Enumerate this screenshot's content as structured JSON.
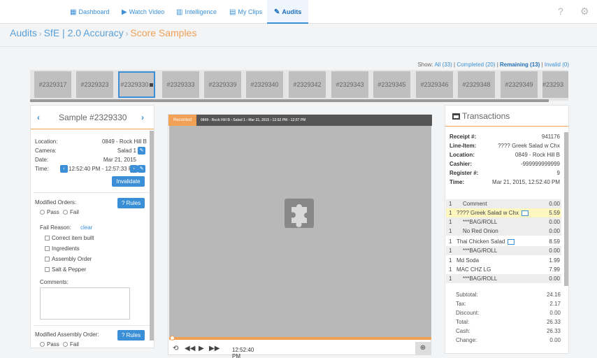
{
  "nav": {
    "items": [
      {
        "label": "Dashboard",
        "icon": "dashboard-icon",
        "active": false
      },
      {
        "label": "Watch Video",
        "icon": "play-circle-icon",
        "active": false
      },
      {
        "label": "Intelligence",
        "icon": "bar-chart-icon",
        "active": false
      },
      {
        "label": "My Clips",
        "icon": "film-icon",
        "active": false
      },
      {
        "label": "Audits",
        "icon": "edit-icon",
        "active": true
      }
    ],
    "help_icon": "help-icon",
    "settings_icon": "gear-icon"
  },
  "breadcrumb": {
    "items": [
      "Audits",
      "SfE | 2.0 Accuracy"
    ],
    "current": "Score Samples"
  },
  "filters": {
    "label": "Show:",
    "all": "All (33)",
    "completed": "Completed (20)",
    "remaining": "Remaining (13)",
    "invalid": "Invalid (0)"
  },
  "samples": [
    "#2329317",
    "#2329323",
    "#2329330",
    "#2329333",
    "#2329339",
    "#2329340",
    "#2329342",
    "#2329343",
    "#2329345",
    "#2329346",
    "#2329348",
    "#2329349",
    "#23293"
  ],
  "selected_sample": "#2329330",
  "sample": {
    "title": "Sample #2329330",
    "location_label": "Location:",
    "location": "0849 - Rock Hill B",
    "camera_label": "Camera:",
    "camera": "Salad 1",
    "date_label": "Date:",
    "date": "Mar 21, 2015",
    "time_label": "Time:",
    "time": "12:52:40 PM - 12:57:33 PM",
    "invalidate": "Invalidate",
    "modified_orders": "Modified Orders:",
    "rules": "? Rules",
    "pass": "Pass",
    "fail": "Fail",
    "fail_reason": "Fail Reason:",
    "clear": "clear",
    "reasons": [
      "Correct item built",
      "Ingredients",
      "Assembly Order",
      "Salt & Pepper"
    ],
    "comments": "Comments:",
    "modified_assembly": "Modified Assembly Order:"
  },
  "video": {
    "badge": "Recorded",
    "info": "0849 - Rock Hill B › Salad 1 › Mar 21, 2015 › 12:52 PM - 12:57 PM",
    "current_time": "12:52:40 PM"
  },
  "transactions": {
    "title": "Transactions",
    "fields": [
      {
        "label": "Receipt #:",
        "value": "941176"
      },
      {
        "label": "Line-Item:",
        "value": "???? Greek Salad w Chx"
      },
      {
        "label": "Location:",
        "value": "0849 - Rock Hill B"
      },
      {
        "label": "Cashier:",
        "value": "-999999999999"
      },
      {
        "label": "Register #:",
        "value": "9"
      },
      {
        "label": "Time:",
        "value": "Mar 21, 2015, 12:52:40 PM"
      }
    ],
    "items": [
      {
        "qty": "1",
        "name": "Comment",
        "amount": "0.00",
        "style": "shade"
      },
      {
        "qty": "1",
        "name": "???? Greek Salad w Chx",
        "amount": "5.59",
        "style": "hl"
      },
      {
        "qty": "1",
        "name": "***BAG/ROLL",
        "amount": "0.00",
        "style": "shade"
      },
      {
        "qty": "1",
        "name": "No Red Onion",
        "amount": "0.00",
        "style": "shade"
      },
      {
        "qty": "1",
        "name": "Thai Chicken Salad",
        "amount": "8.59",
        "style": ""
      },
      {
        "qty": "1",
        "name": "***BAG/ROLL",
        "amount": "0.00",
        "style": "shade"
      },
      {
        "qty": "1",
        "name": "Md Soda",
        "amount": "1.99",
        "style": ""
      },
      {
        "qty": "1",
        "name": "MAC CHZ LG",
        "amount": "7.99",
        "style": ""
      },
      {
        "qty": "1",
        "name": "***BAG/ROLL",
        "amount": "0.00",
        "style": "shade"
      }
    ],
    "totals": [
      {
        "label": "Subtotal:",
        "value": "24.16"
      },
      {
        "label": "Tax:",
        "value": "2.17"
      },
      {
        "label": "Discount:",
        "value": "0.00"
      },
      {
        "label": "Total:",
        "value": "26.33"
      },
      {
        "label": "Cash:",
        "value": "26.33"
      },
      {
        "label": "Change:",
        "value": "0.00"
      }
    ]
  },
  "colors": {
    "accent": "#3a8fd6",
    "orange": "#f0a156",
    "highlight": "#fdf6bf"
  }
}
